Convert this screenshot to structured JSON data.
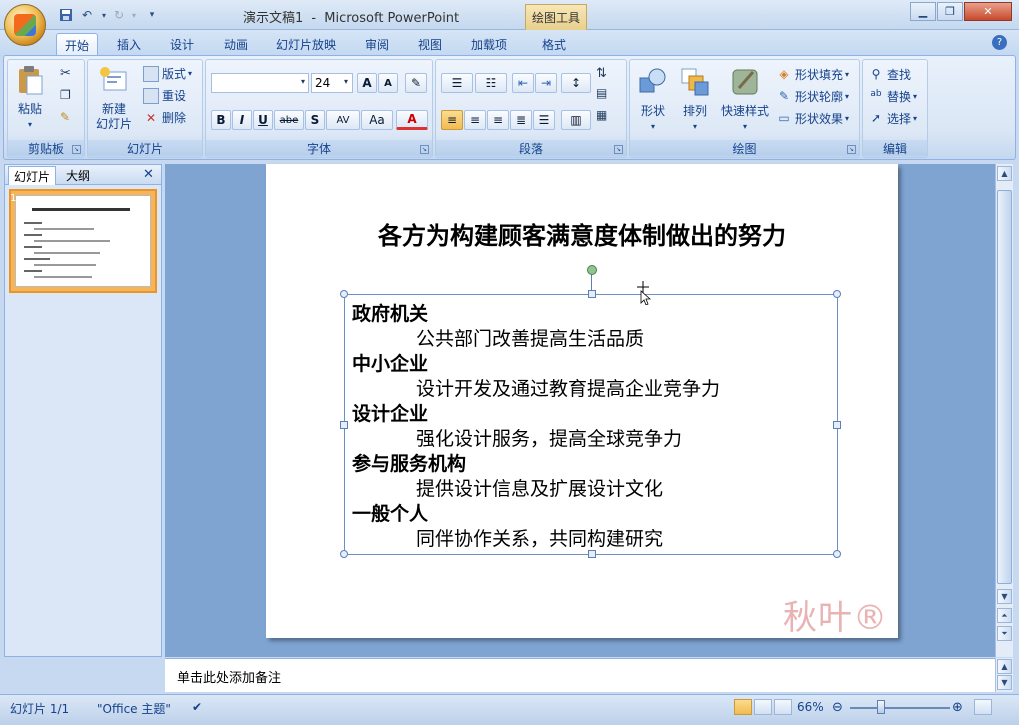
{
  "titlebar": {
    "document": "演示文稿1",
    "separator": "-",
    "app": "Microsoft PowerPoint",
    "context_tab": "绘图工具"
  },
  "tabs": [
    "开始",
    "插入",
    "设计",
    "动画",
    "幻灯片放映",
    "审阅",
    "视图",
    "加载项",
    "格式"
  ],
  "active_tab": "开始",
  "ribbon": {
    "clipboard": {
      "label": "剪贴板",
      "paste": "粘贴"
    },
    "slides": {
      "label": "幻灯片",
      "new_slide_1": "新建",
      "new_slide_2": "幻灯片",
      "layout": "版式",
      "reset": "重设",
      "delete": "删除"
    },
    "font": {
      "label": "字体",
      "font_name": "",
      "font_size": "24",
      "bold": "B",
      "italic": "I",
      "underline": "U",
      "strike": "abe",
      "shadow": "S",
      "spacing": "AV",
      "case": "Aa",
      "grow": "A",
      "shrink": "A",
      "color": "A"
    },
    "paragraph": {
      "label": "段落"
    },
    "drawing": {
      "label": "绘图",
      "shapes": "形状",
      "arrange": "排列",
      "quick_styles": "快速样式",
      "fill": "形状填充",
      "outline": "形状轮廓",
      "effects": "形状效果"
    },
    "editing": {
      "label": "编辑",
      "find": "查找",
      "replace": "替换",
      "select": "选择"
    }
  },
  "leftpane": {
    "tab_slides": "幻灯片",
    "tab_outline": "大纲",
    "close": "✕",
    "thumb_number": "1"
  },
  "slide": {
    "title": "各方为构建顾客满意度体制做出的努力",
    "items": [
      {
        "heading": "政府机关",
        "detail": "公共部门改善提高生活品质"
      },
      {
        "heading": "中小企业",
        "detail": "设计开发及通过教育提高企业竞争力"
      },
      {
        "heading": "设计企业",
        "detail": "强化设计服务，提高全球竞争力"
      },
      {
        "heading": "参与服务机构",
        "detail": "提供设计信息及扩展设计文化"
      },
      {
        "heading": "一般个人",
        "detail": "同伴协作关系，共同构建研究"
      }
    ],
    "watermark": "秋叶®"
  },
  "notes": {
    "placeholder": "单击此处添加备注"
  },
  "status": {
    "slide_counter": "幻灯片 1/1",
    "theme": "\"Office 主题\"",
    "zoom": "66%"
  },
  "colors": {
    "accent": "#c6d9f0",
    "slide_bg": "#ffffff",
    "edit_bg": "#7fa4d2"
  }
}
